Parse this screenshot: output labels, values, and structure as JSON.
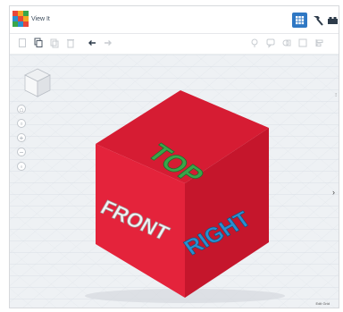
{
  "app": {
    "title": "View It"
  },
  "header": {
    "buttons": [
      {
        "name": "view-3d-button",
        "icon": "grid-icon",
        "active": true
      },
      {
        "name": "build-button",
        "icon": "hammer-icon"
      },
      {
        "name": "sim-button",
        "icon": "brick-icon"
      }
    ]
  },
  "toolbar": {
    "left_icons": [
      "new-icon",
      "copy-icon",
      "paste-icon",
      "delete-icon",
      "undo-icon",
      "redo-icon"
    ],
    "right_icons": [
      "light-icon",
      "comment-icon",
      "shape-icon",
      "group-icon",
      "align-icon"
    ]
  },
  "scene": {
    "cube_color": "#e01e37",
    "faces": {
      "top": "TOP",
      "front": "FRONT",
      "right": "RIGHT"
    },
    "text_colors": {
      "top": "#3aa54a",
      "front": "#f2f2f2",
      "right": "#2a8fd0"
    }
  },
  "footer": {
    "edit_grid": "Edit Grid"
  },
  "side_controls": [
    "home-icon",
    "fit-icon",
    "zoom-in-icon",
    "zoom-out-icon",
    "ortho-icon"
  ]
}
